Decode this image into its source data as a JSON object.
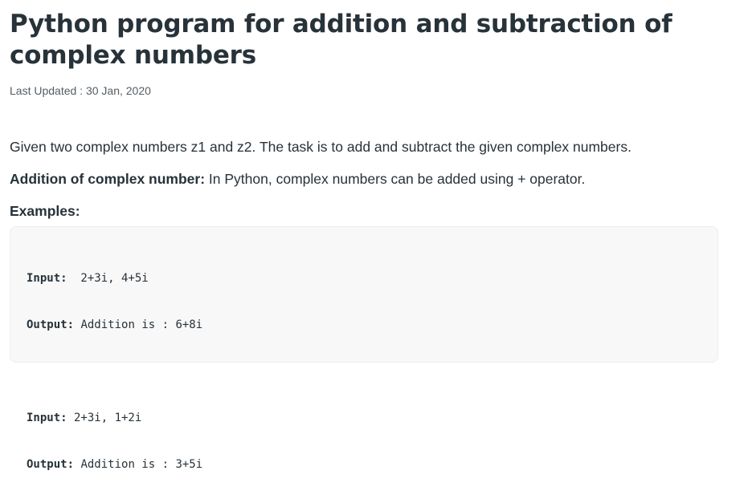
{
  "article": {
    "title": "Python program for addition and subtraction of complex numbers",
    "last_updated": "Last Updated : 30 Jan, 2020",
    "intro": "Given two complex numbers z1 and z2. The task is to add and subtract the given complex numbers.",
    "addition_heading": "Addition of complex number:",
    "addition_text": " In Python, complex numbers can be added using + operator.",
    "examples_heading": "Examples:"
  },
  "examples": [
    {
      "input_label": "Input:",
      "input_value": "  2+3i, 4+5i",
      "output_label": "Output:",
      "output_value": " Addition is : 6+8i"
    },
    {
      "input_label": "Input:",
      "input_value": " 2+3i, 1+2i",
      "output_label": "Output:",
      "output_value": " Addition is : 3+5i"
    }
  ]
}
